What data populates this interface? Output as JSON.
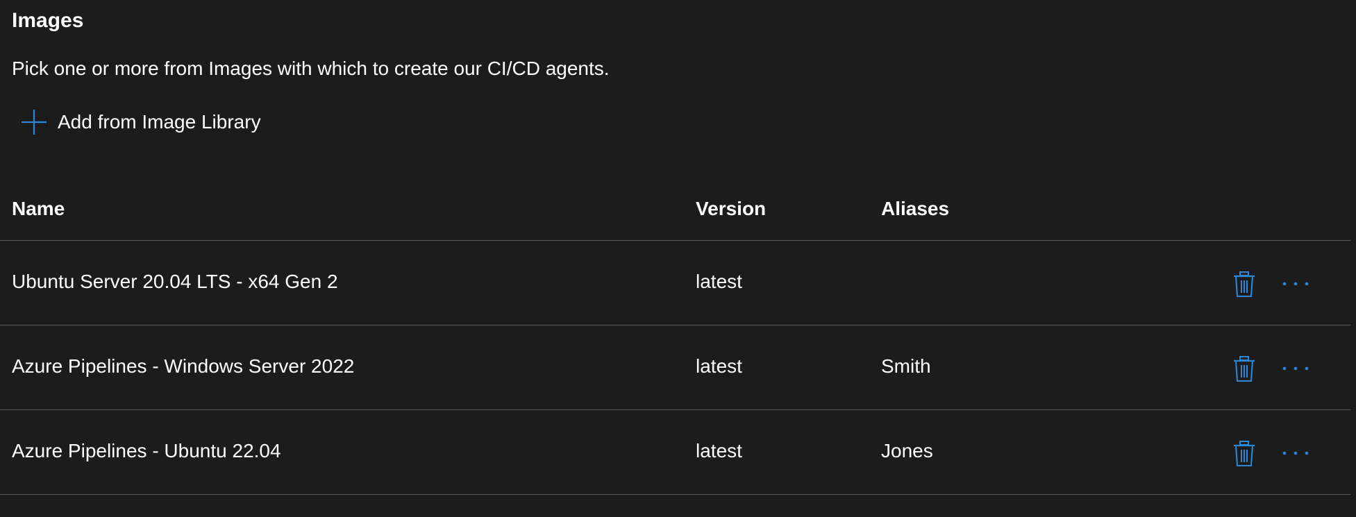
{
  "header": {
    "title": "Images",
    "description": "Pick one or more from Images with which to create our CI/CD agents."
  },
  "actions": {
    "add_label": "Add from Image Library",
    "add_icon": "plus-icon",
    "delete_icon": "trash-icon",
    "more_icon": "more-options-icon"
  },
  "colors": {
    "background": "#1c1c1c",
    "accent": "#2b88d8",
    "divider": "#5a5a5a",
    "text": "#ffffff"
  },
  "table": {
    "columns": {
      "name": "Name",
      "version": "Version",
      "aliases": "Aliases"
    },
    "rows": [
      {
        "name": "Ubuntu Server 20.04 LTS - x64 Gen 2",
        "version": "latest",
        "aliases": ""
      },
      {
        "name": "Azure Pipelines - Windows Server 2022",
        "version": "latest",
        "aliases": "Smith"
      },
      {
        "name": "Azure Pipelines - Ubuntu 22.04",
        "version": "latest",
        "aliases": "Jones"
      }
    ]
  }
}
